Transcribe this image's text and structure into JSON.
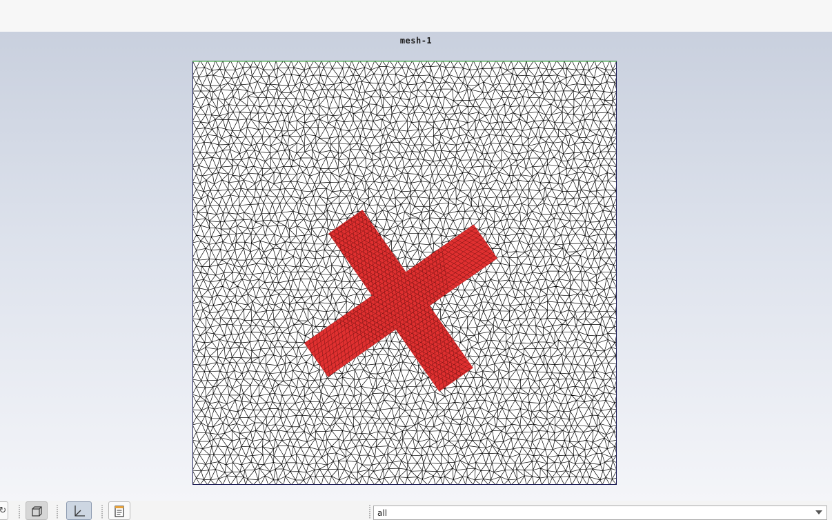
{
  "viewport": {
    "title": "mesh-1",
    "mesh_color": "#000000",
    "highlight_color": "#e03030",
    "background_top": "#c9d0de",
    "background_bottom": "#f4f5f9"
  },
  "toolbar": {
    "buttons": [
      {
        "name": "partial-tool",
        "icon": "rotate-icon"
      },
      {
        "name": "isometric-view",
        "icon": "cube-icon"
      },
      {
        "name": "axes-toggle",
        "icon": "axes-icon"
      },
      {
        "name": "report",
        "icon": "document-icon"
      }
    ],
    "zone_select": {
      "value": "all"
    }
  }
}
